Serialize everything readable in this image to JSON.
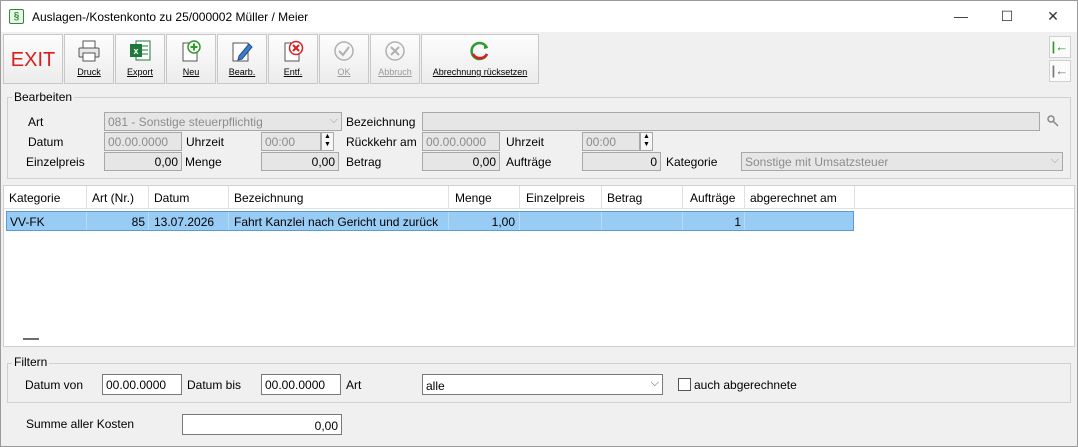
{
  "window": {
    "title": "Auslagen-/Kostenkonto zu 25/000002 Müller / Meier",
    "app_icon": "§"
  },
  "window_controls": {
    "minimize": "—",
    "maximize": "☐",
    "close": "✕"
  },
  "toolbar": {
    "exit_label": "EXIT",
    "print_label": "Druck",
    "export_label": "Export",
    "new_label": "Neu",
    "edit_label": "Bearb.",
    "delete_label": "Entf.",
    "ok_label": "OK",
    "cancel_label": "Abbruch",
    "reset_label": "Abrechnung rücksetzen"
  },
  "edit": {
    "legend": "Bearbeiten",
    "art_label": "Art",
    "art_value": "081 - Sonstige steuerpflichtig",
    "bezeichnung_label": "Bezeichnung",
    "bezeichnung_value": "",
    "datum_label": "Datum",
    "datum_value": "00.00.0000",
    "uhrzeit_label": "Uhrzeit",
    "uhrzeit_value": "00:00",
    "rueckkehr_label": "Rückkehr am",
    "rueckkehr_value": "00.00.0000",
    "uhrzeit2_label": "Uhrzeit",
    "uhrzeit2_value": "00:00",
    "einzelpreis_label": "Einzelpreis",
    "einzelpreis_value": "0,00",
    "menge_label": "Menge",
    "menge_value": "0,00",
    "betrag_label": "Betrag",
    "betrag_value": "0,00",
    "auftraege_label": "Aufträge",
    "auftraege_value": "0",
    "kategorie_label": "Kategorie",
    "kategorie_value": "Sonstige mit Umsatzsteuer"
  },
  "table": {
    "columns": [
      "Kategorie",
      "Art (Nr.)",
      "Datum",
      "Bezeichnung",
      "Menge",
      "Einzelpreis",
      "Betrag",
      "Aufträge",
      "abgerechnet am"
    ],
    "rows": [
      {
        "kategorie": "VV-FK",
        "art": "85",
        "datum": "13.07.2026",
        "bezeichnung": "Fahrt Kanzlei nach Gericht und zurück",
        "menge": "1,00",
        "einzelpreis": "",
        "betrag": "",
        "auftraege": "1",
        "abgerechnet": ""
      }
    ]
  },
  "filter": {
    "legend": "Filtern",
    "datum_von_label": "Datum von",
    "datum_von_value": "00.00.0000",
    "datum_bis_label": "Datum bis",
    "datum_bis_value": "00.00.0000",
    "art_label": "Art",
    "art_value": "alle",
    "abgerechnete_label": "auch abgerechnete",
    "abgerechnete_checked": false
  },
  "summe": {
    "label": "Summe aller Kosten",
    "value": "0,00"
  },
  "colors": {
    "exit_red": "#d81e1e",
    "selection": "#99ccf5",
    "green": "#2e9b2e"
  }
}
